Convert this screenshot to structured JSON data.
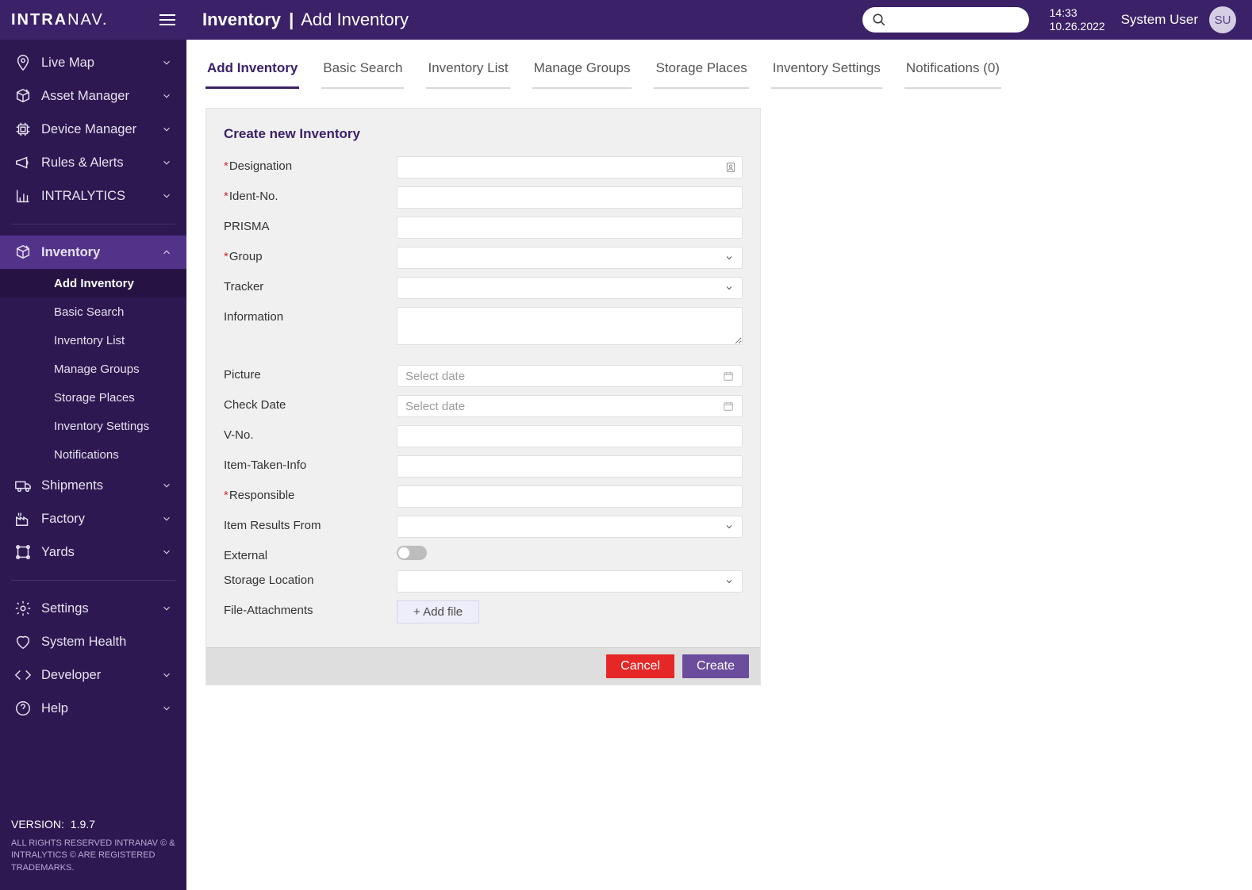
{
  "brand": {
    "part1": "INTRA",
    "part2": "NAV."
  },
  "breadcrumb": {
    "main": "Inventory",
    "sep": "|",
    "sub": "Add Inventory"
  },
  "header": {
    "time": "14:33",
    "date": "10.26.2022",
    "user": "System User",
    "avatar": "SU"
  },
  "sidebar": {
    "items": [
      {
        "label": "Live Map",
        "icon": "map-pin-icon"
      },
      {
        "label": "Asset Manager",
        "icon": "cube-plus-icon"
      },
      {
        "label": "Device Manager",
        "icon": "cpu-icon"
      },
      {
        "label": "Rules & Alerts",
        "icon": "megaphone-icon"
      },
      {
        "label": "INTRALYTICS",
        "icon": "bar-chart-icon"
      }
    ],
    "items2": [
      {
        "label": "Inventory",
        "icon": "cube-plus-icon",
        "expanded": true,
        "sub": [
          {
            "label": "Add Inventory",
            "active": true
          },
          {
            "label": "Basic Search"
          },
          {
            "label": "Inventory List"
          },
          {
            "label": "Manage Groups"
          },
          {
            "label": "Storage Places"
          },
          {
            "label": "Inventory Settings"
          },
          {
            "label": "Notifications"
          }
        ]
      },
      {
        "label": "Shipments",
        "icon": "truck-icon"
      },
      {
        "label": "Factory",
        "icon": "factory-icon"
      },
      {
        "label": "Yards",
        "icon": "polygon-icon"
      }
    ],
    "items3": [
      {
        "label": "Settings",
        "icon": "gear-icon"
      },
      {
        "label": "System Health",
        "icon": "heart-icon",
        "nochev": true
      },
      {
        "label": "Developer",
        "icon": "code-icon"
      },
      {
        "label": "Help",
        "icon": "help-icon"
      }
    ],
    "footer": {
      "version_label": "VERSION:",
      "version": "1.9.7",
      "legal": "ALL RIGHTS RESERVED INTRANAV © & INTRALYTICS © ARE REGISTERED TRADEMARKS."
    }
  },
  "tabs": [
    {
      "label": "Add Inventory",
      "active": true
    },
    {
      "label": "Basic Search"
    },
    {
      "label": "Inventory List"
    },
    {
      "label": "Manage Groups"
    },
    {
      "label": "Storage Places"
    },
    {
      "label": "Inventory Settings"
    },
    {
      "label": "Notifications (0)"
    }
  ],
  "form": {
    "title": "Create new Inventory",
    "date_placeholder": "Select date",
    "addfile": "+ Add file",
    "fields": {
      "designation": {
        "label": "Designation",
        "required": true,
        "type": "text-contact"
      },
      "ident": {
        "label": "Ident-No.",
        "required": true,
        "type": "text"
      },
      "prisma": {
        "label": "PRISMA",
        "type": "text"
      },
      "group": {
        "label": "Group",
        "required": true,
        "type": "select"
      },
      "tracker": {
        "label": "Tracker",
        "type": "select"
      },
      "information": {
        "label": "Information",
        "type": "textarea"
      },
      "picture": {
        "label": "Picture",
        "type": "date"
      },
      "checkdate": {
        "label": "Check Date",
        "type": "date"
      },
      "vno": {
        "label": "V-No.",
        "type": "text"
      },
      "itemtaken": {
        "label": "Item-Taken-Info",
        "type": "text"
      },
      "responsible": {
        "label": "Responsible",
        "required": true,
        "type": "text"
      },
      "resultsfrom": {
        "label": "Item Results From",
        "type": "select"
      },
      "external": {
        "label": "External",
        "type": "toggle"
      },
      "storage": {
        "label": "Storage Location",
        "type": "select"
      },
      "attachments": {
        "label": "File-Attachments",
        "type": "file"
      }
    },
    "buttons": {
      "cancel": "Cancel",
      "create": "Create"
    }
  }
}
